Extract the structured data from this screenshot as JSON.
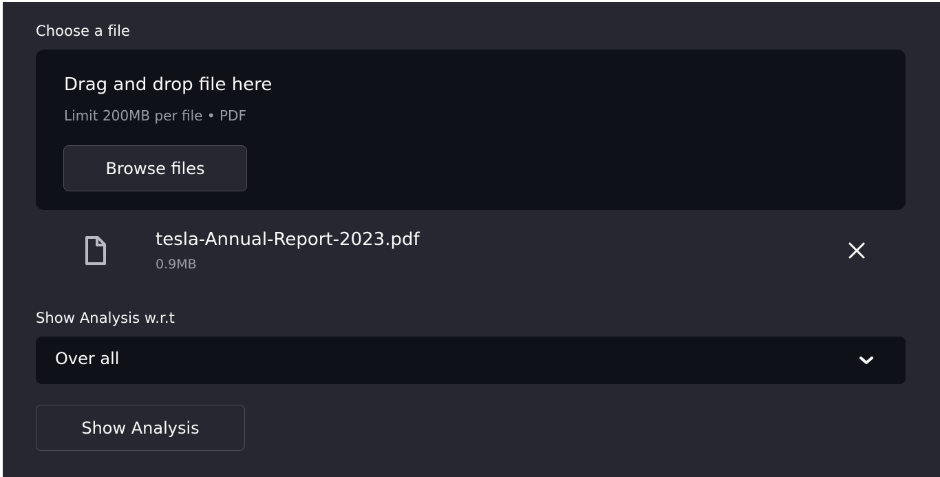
{
  "uploader": {
    "label": "Choose a file",
    "dropzone_title": "Drag and drop file here",
    "limit_text": "Limit 200MB per file • PDF",
    "browse_label": "Browse files"
  },
  "uploaded_file": {
    "name": "tesla-Annual-Report-2023.pdf",
    "size": "0.9MB",
    "icon": "file-icon",
    "remove_icon": "close-icon"
  },
  "analysis": {
    "label": "Show Analysis w.r.t",
    "selected": "Over all",
    "button_label": "Show Analysis"
  },
  "colors": {
    "panel_bg": "#262730",
    "input_bg": "#0e1117",
    "text": "#fafafa",
    "muted_text": "#9a9ca5"
  }
}
